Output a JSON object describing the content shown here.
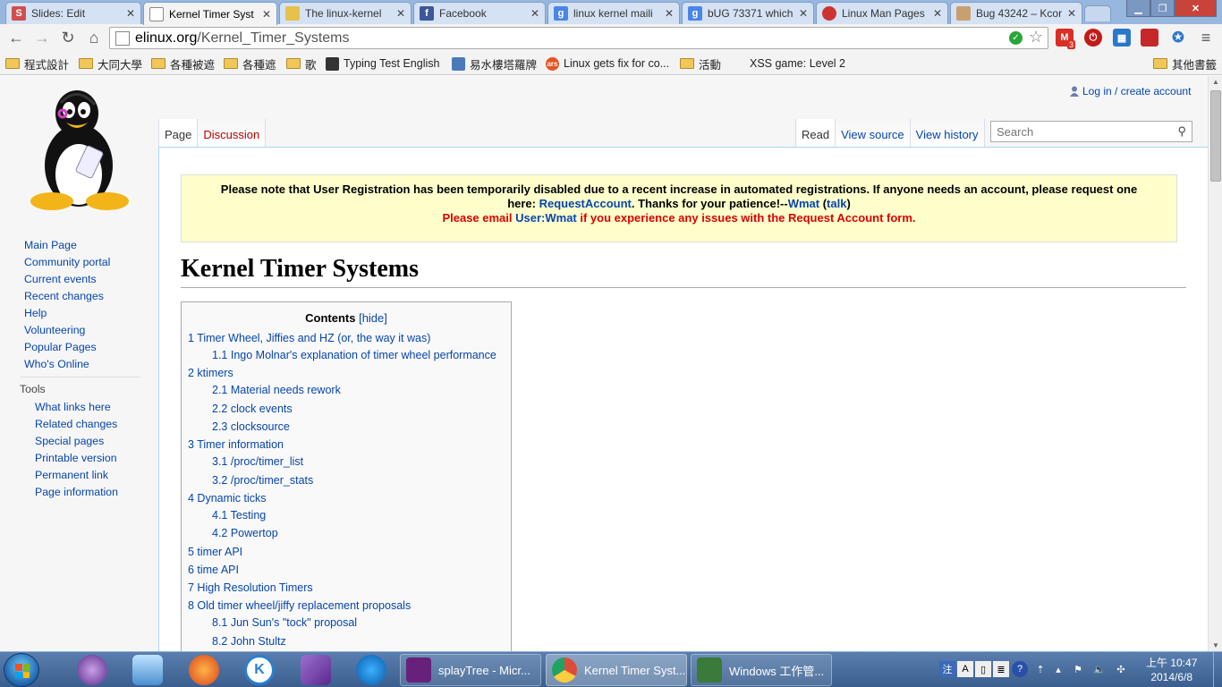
{
  "tabs": [
    {
      "title": "Slides: Edit",
      "favicon_letter": "S",
      "favicon_color": "#d14e4e",
      "active": false
    },
    {
      "title": "Kernel Timer Syst",
      "favicon_letter": "",
      "favicon_color": "#ffffff",
      "active": true
    },
    {
      "title": "The linux-kernel",
      "favicon_letter": "",
      "favicon_color": "#e8c14a",
      "active": false
    },
    {
      "title": "Facebook",
      "favicon_letter": "f",
      "favicon_color": "#3b5998",
      "active": false
    },
    {
      "title": "linux kernel maili",
      "favicon_letter": "g",
      "favicon_color": "#4a86e8",
      "active": false
    },
    {
      "title": "bUG 73371 which",
      "favicon_letter": "g",
      "favicon_color": "#4a86e8",
      "active": false
    },
    {
      "title": "Linux Man Pages",
      "favicon_letter": "",
      "favicon_color": "#cc3333",
      "active": false
    },
    {
      "title": "Bug 43242 – Kcor",
      "favicon_letter": "",
      "favicon_color": "#c8a070",
      "active": false
    }
  ],
  "toolbar": {
    "url_host": "elinux.org",
    "url_path": "/Kernel_Timer_Systems",
    "gmail_badge": "3"
  },
  "bookmarks": [
    {
      "label": "程式設計",
      "type": "folder"
    },
    {
      "label": "大同大學",
      "type": "folder"
    },
    {
      "label": "各種被遮",
      "type": "folder"
    },
    {
      "label": "各種遮",
      "type": "folder"
    },
    {
      "label": "歌",
      "type": "folder"
    },
    {
      "label": "Typing Test English",
      "type": "site",
      "color": "#333333"
    },
    {
      "label": "易水樓塔羅牌",
      "type": "site",
      "color": "#4a7ab8"
    },
    {
      "label": "Linux gets fix for co...",
      "type": "site",
      "color": "#e8541e",
      "icon_text": "ars"
    },
    {
      "label": "活動",
      "type": "folder"
    },
    {
      "label": "XSS game: Level 2",
      "type": "plain"
    },
    {
      "label": "其他書籤",
      "type": "folder"
    }
  ],
  "personal": {
    "login": "Log in / create account"
  },
  "views": {
    "page": "Page",
    "discussion": "Discussion",
    "read": "Read",
    "view_source": "View source",
    "view_history": "View history"
  },
  "search": {
    "placeholder": "Search"
  },
  "sidebar": {
    "nav": [
      "Main Page",
      "Community portal",
      "Current events",
      "Recent changes",
      "Help",
      "Volunteering",
      "Popular Pages",
      "Who's Online"
    ],
    "tools_heading": "Tools",
    "tools": [
      "What links here",
      "Related changes",
      "Special pages",
      "Printable version",
      "Permanent link",
      "Page information"
    ]
  },
  "notice": {
    "line1_a": "Please note that User Registration has been temporarily disabled due to a recent increase in automated registrations. If anyone needs an account, please request one",
    "line1_b_pre": "here: ",
    "link_request": "RequestAccount",
    "line1_b_mid": ". Thanks for your patience!--",
    "link_wmat": "Wmat",
    "link_talk_pre": " (",
    "link_talk": "talk",
    "link_talk_post": ")",
    "line2_pre": "Please email ",
    "link_user_wmat": "User:Wmat",
    "line2_post": " if you experience any issues with the Request Account form."
  },
  "page_title": "Kernel Timer Systems",
  "toc": {
    "title": "Contents",
    "hide": "[hide]",
    "items": [
      {
        "text": "1 Timer Wheel, Jiffies and HZ (or, the way it was)",
        "level": 1
      },
      {
        "text": "1.1 Ingo Molnar's explanation of timer wheel performance",
        "level": 2
      },
      {
        "text": "2 ktimers",
        "level": 1
      },
      {
        "text": "2.1 Material needs rework",
        "level": 2
      },
      {
        "text": "2.2 clock events",
        "level": 2
      },
      {
        "text": "2.3 clocksource",
        "level": 2
      },
      {
        "text": "3 Timer information",
        "level": 1
      },
      {
        "text": "3.1 /proc/timer_list",
        "level": 2
      },
      {
        "text": "3.2 /proc/timer_stats",
        "level": 2
      },
      {
        "text": "4 Dynamic ticks",
        "level": 1
      },
      {
        "text": "4.1 Testing",
        "level": 2
      },
      {
        "text": "4.2 Powertop",
        "level": 2
      },
      {
        "text": "5 timer API",
        "level": 1
      },
      {
        "text": "6 time API",
        "level": 1
      },
      {
        "text": "7 High Resolution Timers",
        "level": 1
      },
      {
        "text": "8 Old timer wheel/jiffy replacement proposals",
        "level": 1
      },
      {
        "text": "8.1 Jun Sun's \"tock\" proposal",
        "level": 2
      },
      {
        "text": "8.2 John Stultz",
        "level": 2
      }
    ]
  },
  "taskbar": {
    "buttons": [
      {
        "label": "splayTree - Micr...",
        "color": "#68217a"
      },
      {
        "label": "Kernel Timer Syst...",
        "color": "#dd4b39"
      },
      {
        "label": "Windows 工作管...",
        "color": "#3a7a3a"
      }
    ],
    "clock_time": "上午 10:47",
    "clock_date": "2014/6/8"
  }
}
